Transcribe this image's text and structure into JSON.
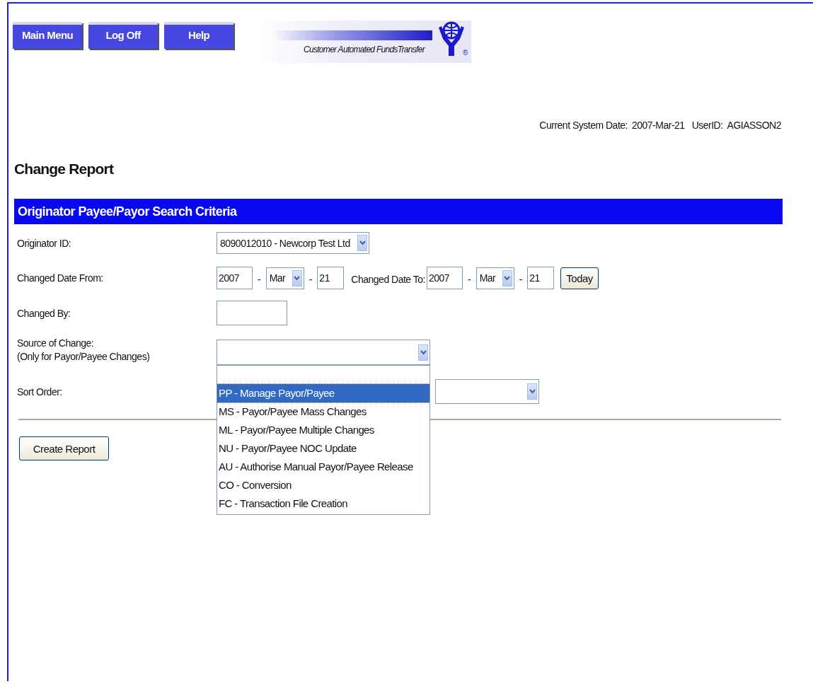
{
  "nav_buttons": [
    {
      "label": "Main Menu"
    },
    {
      "label": "Log Off"
    },
    {
      "label": "Help"
    }
  ],
  "logo": {
    "text": "Customer Automated FundsTransfer",
    "registered_mark": "®"
  },
  "system_info": {
    "date_label": "Current System Date:",
    "date": "2007-Mar-21",
    "user_label": "UserID:",
    "user": "AGIASSON2"
  },
  "page_title": "Change Report",
  "section_title": "Originator Payee/Payor Search Criteria",
  "originator": {
    "label": "Originator ID:",
    "value": "8090012010 - Newcorp Test Ltd"
  },
  "date_from": {
    "label": "Changed Date From:",
    "year": "2007",
    "month": "Mar",
    "day": "21",
    "separator": "-"
  },
  "date_to": {
    "label": "Changed Date To:",
    "year": "2007",
    "month": "Mar",
    "day": "21",
    "separator": "-"
  },
  "today_button": "Today",
  "changed_by": {
    "label": "Changed By:"
  },
  "source_of_change": {
    "label": "Source of Change:",
    "note": "(Only for Payor/Payee Changes)",
    "expanded": true,
    "options": [
      {
        "label": "PP - Manage Payor/Payee",
        "selected": true
      },
      {
        "label": "MS - Payor/Payee Mass Changes",
        "selected": false
      },
      {
        "label": "ML - Payor/Payee Multiple Changes",
        "selected": false
      },
      {
        "label": "NU - Payor/Payee NOC Update",
        "selected": false
      },
      {
        "label": "AU - Authorise Manual Payor/Payee Release",
        "selected": false
      },
      {
        "label": "CO - Conversion",
        "selected": false
      },
      {
        "label": "FC - Transaction File Creation",
        "selected": false
      }
    ]
  },
  "sort_order": {
    "label": "Sort Order:"
  },
  "create_button": "Create Report"
}
